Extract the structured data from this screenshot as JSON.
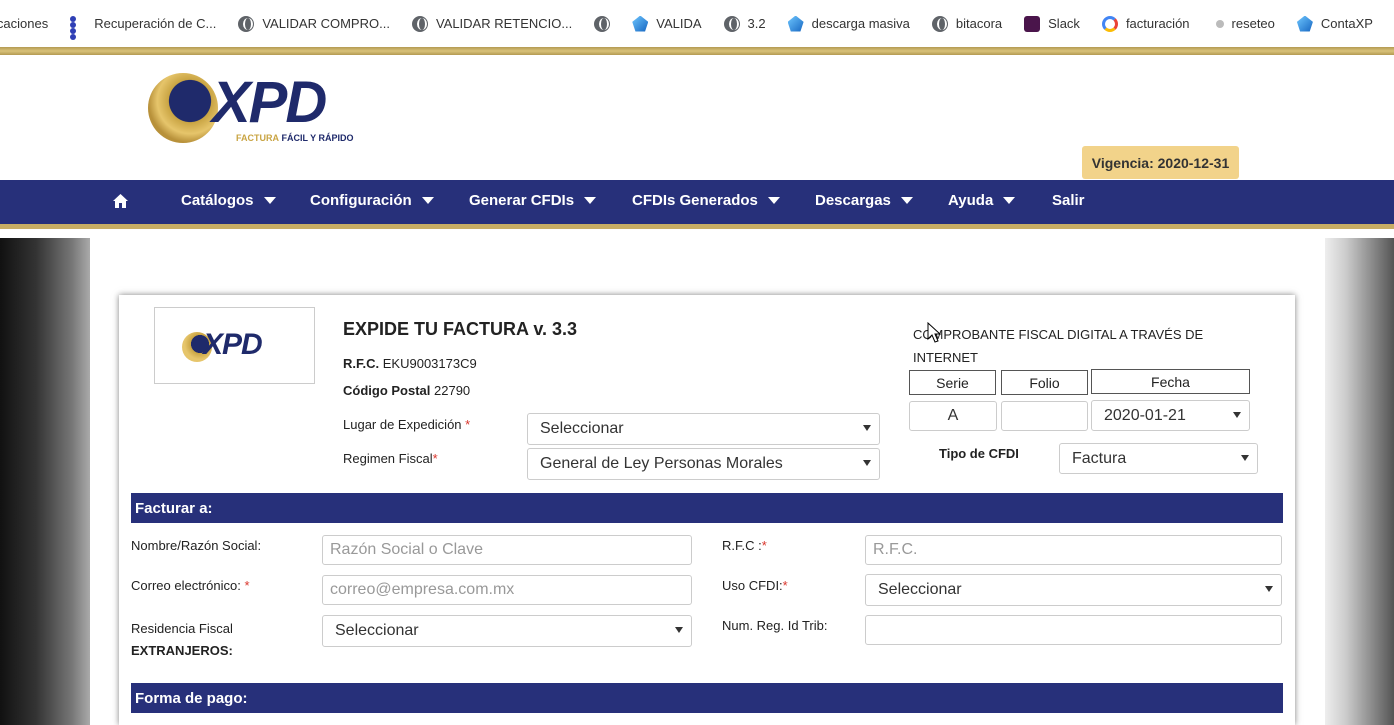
{
  "bookmarks": [
    {
      "label": "icaciones",
      "icon": "none"
    },
    {
      "label": "Recuperación de C...",
      "icon": "dots-icon"
    },
    {
      "label": "VALIDAR COMPRO...",
      "icon": "globe-icon"
    },
    {
      "label": "VALIDAR RETENCIO...",
      "icon": "globe-icon"
    },
    {
      "label": "VALIDA",
      "icon": "drop-icon"
    },
    {
      "label": "3.2",
      "icon": "globe-icon"
    },
    {
      "label": "descarga masiva",
      "icon": "drop-icon"
    },
    {
      "label": "bitacora",
      "icon": "globe-icon"
    },
    {
      "label": "Slack",
      "icon": "slack-icon"
    },
    {
      "label": "facturación",
      "icon": "google-icon"
    },
    {
      "label": "reseteo",
      "icon": "small-icon"
    },
    {
      "label": "ContaXP",
      "icon": "drop-icon"
    }
  ],
  "header": {
    "logo_text": "XPD",
    "logo_sub_gold": "FACTURA",
    "logo_sub_rest": " FÁCIL Y RÁPIDO",
    "vigencia": "Vigencia: 2020-12-31"
  },
  "nav": {
    "items": [
      "Catálogos",
      "Configuración",
      "Generar CFDIs",
      "CFDIs Generados",
      "Descargas",
      "Ayuda",
      "Salir"
    ]
  },
  "form": {
    "small_logo_text": "XPD",
    "title": "EXPIDE TU FACTURA v. 3.3",
    "rfc_label": "R.F.C.",
    "rfc_value": "EKU9003173C9",
    "cp_label": "Código Postal",
    "cp_value": "22790",
    "lugar_label": "Lugar de Expedición",
    "lugar_value": "Seleccionar",
    "regimen_label": "Regimen Fiscal",
    "regimen_value": "General de Ley Personas Morales",
    "comprobante_line1": "COMPROBANTE FISCAL DIGITAL A TRAVÉS DE",
    "comprobante_line2": "INTERNET",
    "serie_label": "Serie",
    "folio_label": "Folio",
    "fecha_label": "Fecha",
    "serie_value": "A",
    "folio_value": "",
    "fecha_value": "2020-01-21",
    "tipo_label": "Tipo de CFDI",
    "tipo_value": "Factura",
    "section_facturar": "Facturar a:",
    "nombre_label": "Nombre/Razón Social:",
    "nombre_placeholder": "Razón Social o Clave",
    "rfc2_label": "R.F.C :",
    "rfc2_placeholder": "R.F.C.",
    "correo_label": "Correo electrónico:",
    "correo_placeholder": "correo@empresa.com.mx",
    "uso_label": "Uso CFDI:",
    "uso_value": "Seleccionar",
    "residencia_label": "Residencia Fiscal",
    "residencia_sub": "EXTRANJEROS:",
    "residencia_value": "Seleccionar",
    "numreg_label": "Num. Reg. Id Trib:",
    "numreg_value": "",
    "section_pago": "Forma de pago:",
    "required_mark": "*"
  }
}
